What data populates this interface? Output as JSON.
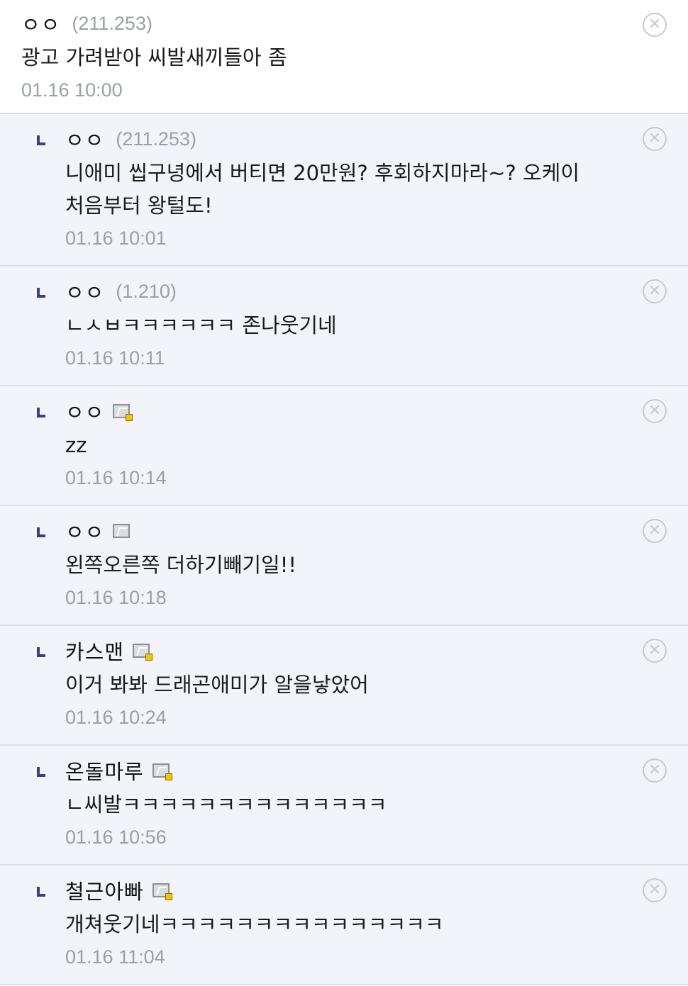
{
  "comments": [
    {
      "nick": "ㅇㅇ",
      "ip": "(211.253)",
      "text": "광고 가려받아 씨발새끼들아 좀",
      "time": "01.16 10:00"
    },
    {
      "nick": "ㅇㅇ",
      "ip": "(211.253)",
      "text": "니애미 씹구녕에서 버티면 20만원? 후회하지마라~? 오케이 처음부터 왕털도!",
      "time": "01.16 10:01"
    },
    {
      "nick": "ㅇㅇ",
      "ip": "(1.210)",
      "text": "ㄴㅅㅂㅋㅋㅋㅋㅋㅋ 존나웃기네",
      "time": "01.16 10:11"
    },
    {
      "nick": "ㅇㅇ",
      "ip": "",
      "text": "zz",
      "time": "01.16 10:14",
      "badge": "gold"
    },
    {
      "nick": "ㅇㅇ",
      "ip": "",
      "text": "왼쪽오른쪽 더하기빼기일!!",
      "time": "01.16 10:18",
      "badge": "plain"
    },
    {
      "nick": "카스맨",
      "ip": "",
      "text": "이거 봐봐 드래곤애미가 알을낳았어",
      "time": "01.16 10:24",
      "badge": "gold"
    },
    {
      "nick": "온돌마루",
      "ip": "",
      "text": "ㄴ씨발ㅋㅋㅋㅋㅋㅋㅋㅋㅋㅋㅋㅋㅋㅋ",
      "time": "01.16 10:56",
      "badge": "gold"
    },
    {
      "nick": "철근아빠",
      "ip": "",
      "text": "개쳐웃기네ㅋㅋㅋㅋㅋㅋㅋㅋㅋㅋㅋㅋㅋㅋㅋ",
      "time": "01.16 11:04",
      "badge": "gold"
    }
  ],
  "icons": {
    "delete": "close-circle-icon",
    "reply": "reply-arrow-icon",
    "badge": "fixed-nick-icon"
  },
  "colors": {
    "reply_bg": "#f3f4f9",
    "reply_mark": "#3b3f8c",
    "meta": "#9aa0a6",
    "divider": "#dcdfe6"
  }
}
